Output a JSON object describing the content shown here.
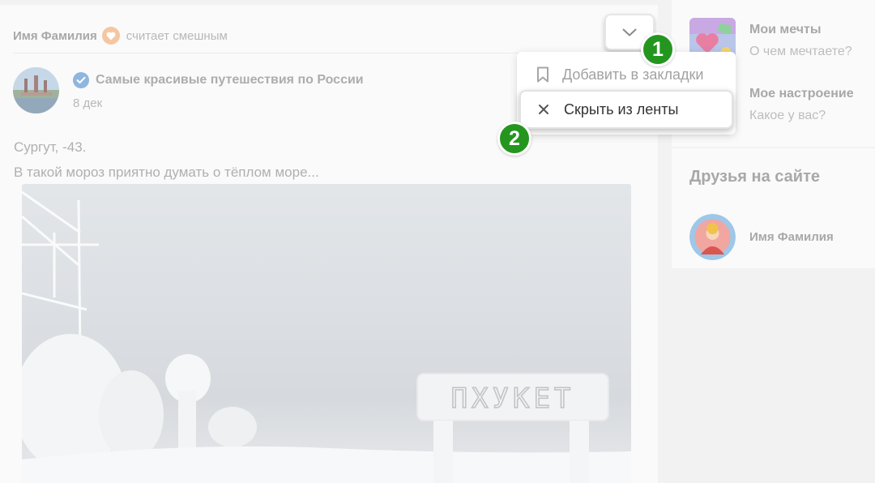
{
  "feed_header": {
    "user_name": "Имя Фамилия",
    "action": "считает смешным"
  },
  "post": {
    "group_name": "Самые красивые путешествия по России",
    "date": "8 дек",
    "text_line1": "Сургут, -43.",
    "text_line2": "В такой мороз приятно думать о тёплом море...",
    "photo_sign": "ПХУКЕТ"
  },
  "context_menu": {
    "items": [
      {
        "label": "Добавить в закладки",
        "icon": "bookmark-icon"
      },
      {
        "label": "Скрыть из ленты",
        "icon": "close-icon"
      }
    ]
  },
  "sidebar": {
    "moods": [
      {
        "title": "Мои мечты",
        "subtitle": "О чем мечтаете?"
      },
      {
        "title": "Мое настроение",
        "subtitle": "Какое у вас?"
      }
    ],
    "friends": {
      "title": "Друзья на сайте",
      "items": [
        {
          "name": "Имя Фамилия"
        }
      ]
    }
  },
  "steps": [
    "1",
    "2"
  ],
  "colors": {
    "step_badge": "#24961f",
    "verified": "#8fb6df",
    "heart": "#f5c6a2"
  }
}
